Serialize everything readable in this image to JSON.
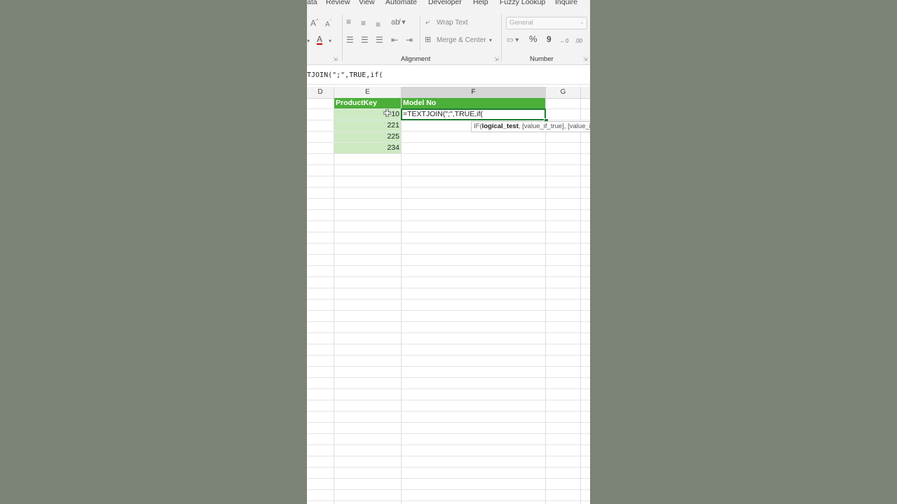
{
  "menu": [
    "ata",
    "Review",
    "View",
    "Automate",
    "Developer",
    "Help",
    "Fuzzy Lookup",
    "Inquire"
  ],
  "ribbon": {
    "wrap_text": "Wrap Text",
    "merge_center": "Merge & Center",
    "number_format": "General",
    "groups": {
      "alignment": "Alignment",
      "number": "Number"
    },
    "percent": "%",
    "comma": "9"
  },
  "formula_bar": {
    "text": "TJOIN(\";\",TRUE,if("
  },
  "columns": [
    "D",
    "E",
    "F",
    "G"
  ],
  "active_column": "F",
  "sheet": {
    "header_row": [
      "ProductKey",
      "Model No"
    ],
    "product_keys": [
      "210",
      "221",
      "225",
      "234"
    ],
    "active_cell_text": "=TEXTJOIN(\";\",TRUE,if(",
    "visible_first_key": "10"
  },
  "tooltip": {
    "fn": "IF(",
    "arg1": "logical_test",
    "rest": ", [value_if_true], [value_if_f"
  },
  "colors": {
    "header_green": "#4caf3a",
    "key_fill": "#cdeac3",
    "active_border": "#1e7a34",
    "background": "#7b8477"
  }
}
